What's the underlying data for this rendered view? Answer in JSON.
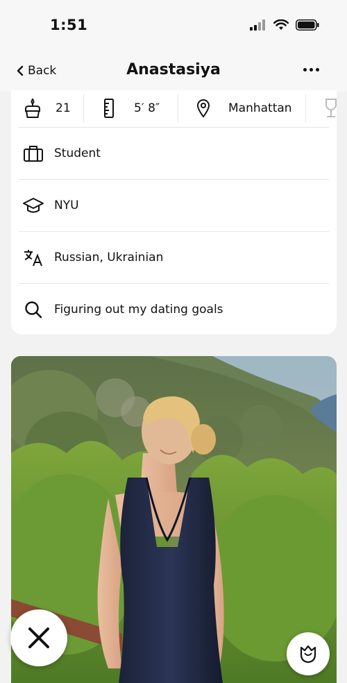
{
  "status_bar": {
    "time": "1:51"
  },
  "nav": {
    "back_label": "Back",
    "title": "Anastasiya"
  },
  "stats": [
    {
      "icon": "cake-icon",
      "value": "21"
    },
    {
      "icon": "ruler-icon",
      "value": "5′ 8″"
    },
    {
      "icon": "location-pin-icon",
      "value": "Manhattan"
    },
    {
      "icon": "wine-glass-icon",
      "value": ""
    }
  ],
  "info": {
    "job": "Student",
    "school": "NYU",
    "languages": "Russian, Ukrainian",
    "dating_goals": "Figuring out my dating goals"
  },
  "photo": {
    "description_icon": "profile-photo"
  },
  "actions": {
    "dislike_icon": "x-icon",
    "rose_icon": "rose-icon"
  },
  "colors": {
    "background": "#f2f2f2",
    "card": "#ffffff",
    "text": "#111111",
    "divider": "#e6e6e6"
  }
}
